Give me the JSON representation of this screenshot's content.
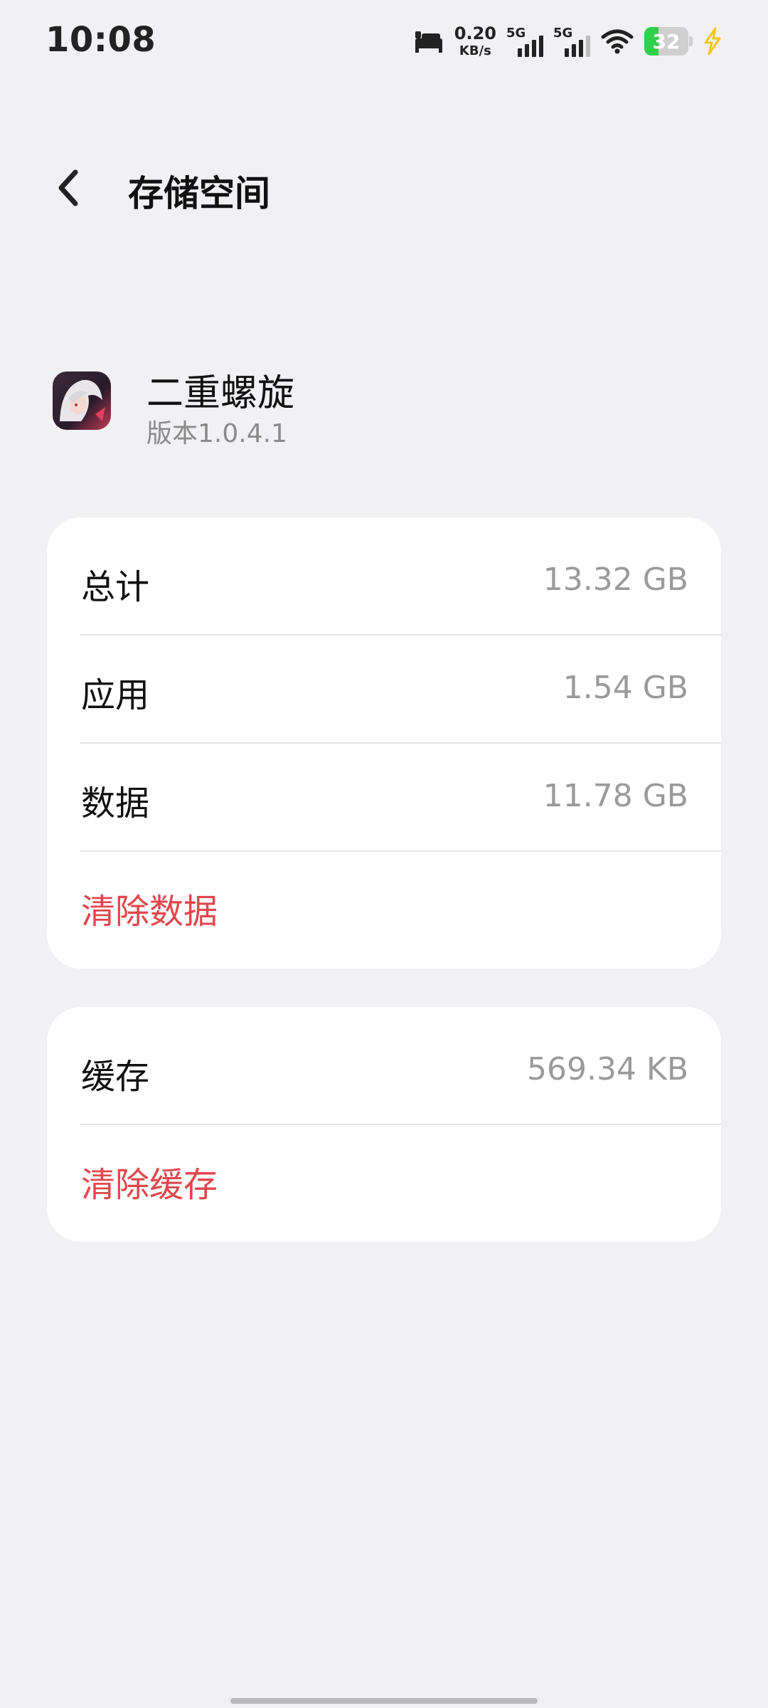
{
  "status_bar": {
    "time": "10:08",
    "net_speed_value": "0.20",
    "net_speed_unit": "KB/s",
    "sim1_label": "5G",
    "sim2_label": "5G",
    "battery_level": "32",
    "battery_fraction": 0.32,
    "battery_color": "#2fd04a",
    "charging_color": "#f5c518",
    "icons": [
      "sleep-bed-icon",
      "wifi-icon",
      "charging-bolt-icon"
    ]
  },
  "header": {
    "title": "存储空间",
    "back_icon": "chevron-left-icon"
  },
  "app": {
    "name": "二重螺旋",
    "version": "版本1.0.4.1"
  },
  "storage_card": {
    "rows": [
      {
        "label": "总计",
        "value": "13.32 GB"
      },
      {
        "label": "应用",
        "value": "1.54 GB"
      },
      {
        "label": "数据",
        "value": "11.78 GB"
      }
    ],
    "action": "清除数据"
  },
  "cache_card": {
    "rows": [
      {
        "label": "缓存",
        "value": "569.34 KB"
      }
    ],
    "action": "清除缓存"
  },
  "colors": {
    "background": "#f1f1f3",
    "card": "#ffffff",
    "accent_red": "#e0474c",
    "secondary_text": "#9a9a9a"
  }
}
